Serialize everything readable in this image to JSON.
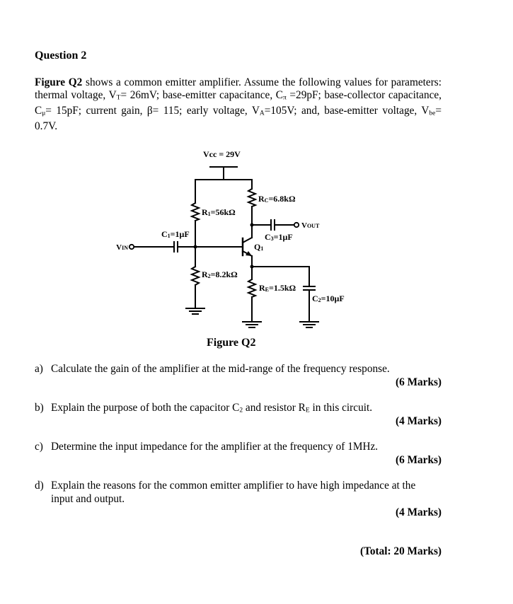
{
  "question": {
    "title": "Question 2",
    "intro": {
      "figure_ref": "Figure Q2",
      "text_1": " shows a common emitter amplifier. Assume the following values for parameters: thermal voltage, V",
      "vt_sub": "T",
      "text_2": "= 26mV; base-emitter capacitance, C",
      "cpi_sub": "π",
      "text_3": " =29pF; base-collector capacitance, C",
      "cmu_sub": "μ",
      "text_4": "= 15pF; current gain, β= 115; early voltage, V",
      "va_sub": "A",
      "text_5": "=105V; and, base-emitter voltage, V",
      "vbe_sub": "be",
      "text_6": "= 0.7V."
    }
  },
  "figure": {
    "caption": "Figure Q2",
    "labels": {
      "vcc": "Vcc = 29V",
      "rc": "Rc=6.8kΩ",
      "rc_main": "R",
      "rc_sub": "C",
      "rc_val": "=6.8kΩ",
      "r1_main": "R",
      "r1_sub": "1",
      "r1_val": "=56kΩ",
      "r2_main": "R",
      "r2_sub": "2",
      "r2_val": "=8.2kΩ",
      "re_main": "R",
      "re_sub": "E",
      "re_val": "=1.5kΩ",
      "c1_main": "C",
      "c1_sub": "1",
      "c1_val": "=1μF",
      "c2_main": "C",
      "c2_sub": "2",
      "c2_val": "=10μF",
      "c3_main": "C",
      "c3_sub": "3",
      "c3_val": "=1μF",
      "q1_main": "Q",
      "q1_sub": "1",
      "vin_main": "V",
      "vin_sub": "IN",
      "vout_main": "V",
      "vout_sub": "OUT"
    }
  },
  "parts": [
    {
      "label": "a)",
      "text": "Calculate the gain of the amplifier at the mid-range of the frequency response.",
      "marks": "(6 Marks)"
    },
    {
      "label": "b)",
      "text_1": "Explain the purpose of both the capacitor C",
      "c_sub": "2",
      "text_2": " and resistor R",
      "r_sub": "E",
      "text_3": " in this circuit.",
      "marks": "(4 Marks)"
    },
    {
      "label": "c)",
      "text": "Determine the input impedance for the amplifier at the frequency of 1MHz.",
      "marks": "(6 Marks)"
    },
    {
      "label": "d)",
      "text_line1": "Explain the reasons for the common emitter amplifier to have high impedance at the",
      "text_line2": "input and output.",
      "marks": "(4 Marks)"
    }
  ],
  "total": "(Total: 20 Marks)"
}
